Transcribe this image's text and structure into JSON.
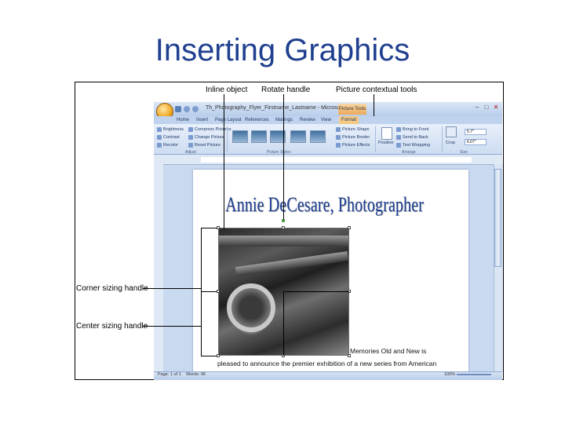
{
  "slide": {
    "title": "Inserting Graphics"
  },
  "callouts": {
    "inline_object": "Inline object",
    "rotate_handle": "Rotate handle",
    "picture_contextual_tools": "Picture contextual tools",
    "corner_sizing_handle": "Corner sizing handle",
    "center_sizing_handle": "Center sizing handle"
  },
  "word": {
    "doc_title": "Th_Photography_Flyer_Firstname_Lastname - Microsoft Wo...",
    "context_tools": "Picture Tools",
    "tabs": [
      "Home",
      "Insert",
      "Page Layout",
      "References",
      "Mailings",
      "Review",
      "View",
      "Format"
    ],
    "active_tab": "Format",
    "ribbon": {
      "adjust": [
        "Brightness",
        "Contrast",
        "Recolor"
      ],
      "adjust2": [
        "Compress Pictures",
        "Change Picture",
        "Reset Picture"
      ],
      "adjust_label": "Adjust",
      "styles_label": "Picture Styles",
      "picture_opts": [
        "Picture Shape",
        "Picture Border",
        "Picture Effects"
      ],
      "position": "Position",
      "arrange": [
        "Bring to Front",
        "Send to Back",
        "Text Wrapping"
      ],
      "arrange_label": "Arrange",
      "size_height": "5.7\"",
      "size_width": "6.07\"",
      "crop": "Crop",
      "size_label": "Size"
    },
    "document": {
      "heading": "Annie DeCesare, Photographer",
      "line1": "Memories Old and New is",
      "line2": "pleased to announce the premier exhibition of a new series from American"
    },
    "status": {
      "page": "Page: 1 of 1",
      "words": "Words: 96",
      "zoom": "100%"
    }
  }
}
